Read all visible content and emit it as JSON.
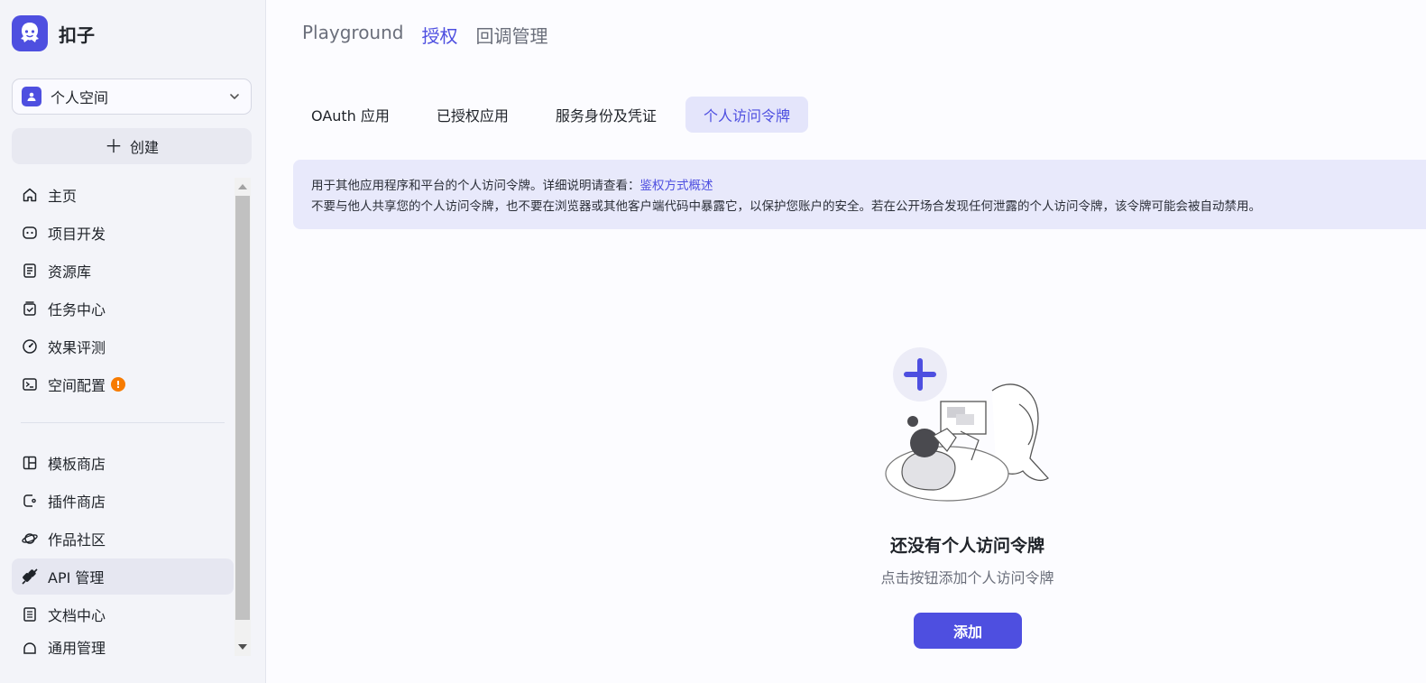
{
  "brand": {
    "name": "扣子"
  },
  "space_selector": {
    "label": "个人空间"
  },
  "create_button": {
    "label": "创建"
  },
  "nav": {
    "items": [
      {
        "label": "主页",
        "icon": "home-icon"
      },
      {
        "label": "项目开发",
        "icon": "bot-icon"
      },
      {
        "label": "资源库",
        "icon": "library-icon"
      },
      {
        "label": "任务中心",
        "icon": "task-icon"
      },
      {
        "label": "效果评测",
        "icon": "gauge-icon"
      },
      {
        "label": "空间配置",
        "icon": "terminal-icon",
        "badge": "!"
      }
    ],
    "bottom_items": [
      {
        "label": "模板商店",
        "icon": "template-icon"
      },
      {
        "label": "插件商店",
        "icon": "plugin-icon"
      },
      {
        "label": "作品社区",
        "icon": "planet-icon"
      },
      {
        "label": "API 管理",
        "icon": "api-icon",
        "active": true
      },
      {
        "label": "文档中心",
        "icon": "doc-icon"
      },
      {
        "label": "通用管理",
        "icon": "settings-icon"
      }
    ]
  },
  "top_tabs": [
    "Playground",
    "授权",
    "回调管理"
  ],
  "sub_tabs": [
    "OAuth 应用",
    "已授权应用",
    "服务身份及凭证",
    "个人访问令牌"
  ],
  "notice": {
    "line1_prefix": "用于其他应用程序和平台的个人访问令牌。详细说明请查看：",
    "line1_link": "鉴权方式概述",
    "line2": "不要与他人共享您的个人访问令牌，也不要在浏览器或其他客户端代码中暴露它，以保护您账户的安全。若在公开场合发现任何泄露的个人访问令牌，该令牌可能会被自动禁用。"
  },
  "empty_state": {
    "title": "还没有个人访问令牌",
    "subtitle": "点击按钮添加个人访问令牌",
    "button": "添加"
  },
  "colors": {
    "accent": "#4e4fe0",
    "badge": "#f77b00"
  }
}
